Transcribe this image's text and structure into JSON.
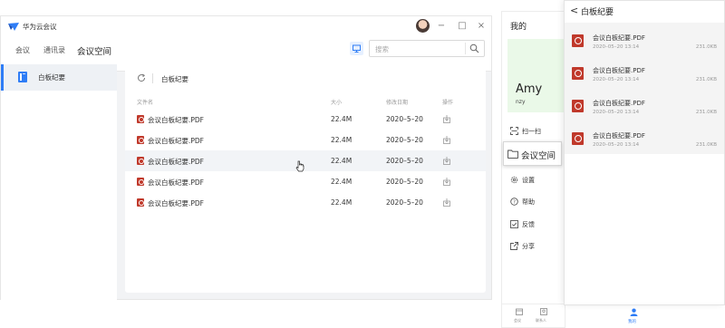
{
  "app": {
    "title": "华为云会议"
  },
  "nav": {
    "items": [
      "会议",
      "通讯录",
      "会议空间"
    ],
    "active": "会议空间"
  },
  "search": {
    "placeholder": "搜索"
  },
  "sidebar": {
    "items": [
      {
        "label": "白板纪要",
        "icon": "whiteboard-icon"
      }
    ]
  },
  "panel": {
    "title": "白板纪要",
    "columns": {
      "name": "文件名",
      "size": "大小",
      "date": "修改日期",
      "action": "操作"
    },
    "rows": [
      {
        "name": "会议白板纪要.PDF",
        "size": "22.4M",
        "date": "2020–5–20"
      },
      {
        "name": "会议白板纪要.PDF",
        "size": "22.4M",
        "date": "2020–5–20"
      },
      {
        "name": "会议白板纪要.PDF",
        "size": "22.4M",
        "date": "2020–5–20"
      },
      {
        "name": "会议白板纪要.PDF",
        "size": "22.4M",
        "date": "2020–5–20"
      },
      {
        "name": "会议白板纪要.PDF",
        "size": "22.4M",
        "date": "2020–5–20"
      }
    ]
  },
  "phone1": {
    "title": "我的",
    "profile": {
      "name": "Amy",
      "sub": "nzy"
    },
    "menu": [
      "扫一扫",
      "会议空间",
      "设置",
      "帮助",
      "反馈",
      "分享"
    ],
    "tabs": [
      "会议",
      "联系人",
      "我的"
    ],
    "accent": "#2f7df6"
  },
  "phone2": {
    "back": "<",
    "title": "白板纪要",
    "files": [
      {
        "name": "会议白板纪要.PDF",
        "meta": "2020–05–20  13:14",
        "size": "231.0KB"
      },
      {
        "name": "会议白板纪要.PDF",
        "meta": "2020–05–20  13:14",
        "size": "231.0KB"
      },
      {
        "name": "会议白板纪要.PDF",
        "meta": "2020–05–20  13:14",
        "size": "231.0KB"
      },
      {
        "name": "会议白板纪要.PDF",
        "meta": "2020–05–20  13:14",
        "size": "231.0KB"
      }
    ]
  }
}
